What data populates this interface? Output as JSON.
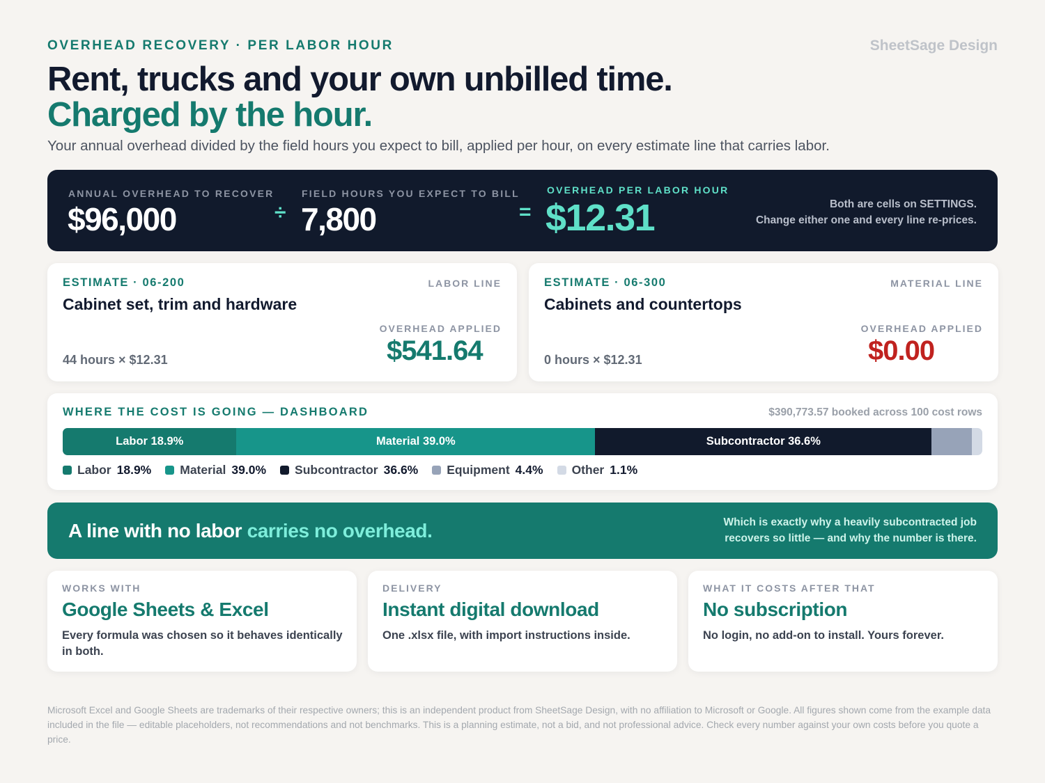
{
  "brand": "SheetSage Design",
  "eyebrow": "OVERHEAD RECOVERY · PER LABOR HOUR",
  "headline": "Rent, trucks and your own unbilled time.",
  "headline_accent": "Charged by the hour.",
  "subheadline": "Your annual overhead divided by the field hours you expect to bill, applied per hour, on every estimate line that carries labor.",
  "formula": {
    "overhead_label": "ANNUAL OVERHEAD TO RECOVER",
    "overhead_value": "$96,000",
    "divide_symbol": "÷",
    "hours_label": "FIELD HOURS YOU EXPECT TO BILL",
    "hours_value": "7,800",
    "equals_symbol": "=",
    "rate_label": "OVERHEAD PER LABOR HOUR",
    "rate_value": "$12.31",
    "note_line1": "Both are cells on SETTINGS.",
    "note_line2": "Change either one and every line re-prices."
  },
  "estimates": [
    {
      "code": "ESTIMATE · 06-200",
      "kind": "LABOR LINE",
      "title": "Cabinet set, trim and hardware",
      "applied_label": "OVERHEAD APPLIED",
      "formula": "44 hours × $12.31",
      "applied": "$541.64",
      "color": "#157a6e"
    },
    {
      "code": "ESTIMATE · 06-300",
      "kind": "MATERIAL LINE",
      "title": "Cabinets and countertops",
      "applied_label": "OVERHEAD APPLIED",
      "formula": "0 hours × $12.31",
      "applied": "$0.00",
      "color": "#c0221f"
    }
  ],
  "dashboard": {
    "title": "WHERE THE COST IS GOING — DASHBOARD",
    "booked": "$390,773.57 booked across 100 cost rows",
    "segments": [
      {
        "name": "Labor",
        "percent": 18.9,
        "pct_label": "18.9%",
        "bar_label": "Labor 18.9%",
        "color": "#157a6e"
      },
      {
        "name": "Material",
        "percent": 39.0,
        "pct_label": "39.0%",
        "bar_label": "Material 39.0%",
        "color": "#17958a"
      },
      {
        "name": "Subcontractor",
        "percent": 36.6,
        "pct_label": "36.6%",
        "bar_label": "Subcontractor 36.6%",
        "color": "#111a2c"
      },
      {
        "name": "Equipment",
        "percent": 4.4,
        "pct_label": "4.4%",
        "bar_label": "",
        "color": "#97a3b8"
      },
      {
        "name": "Other",
        "percent": 1.1,
        "pct_label": "1.1%",
        "bar_label": "",
        "color": "#d3dae5"
      }
    ]
  },
  "callout": {
    "main": "A line with no labor ",
    "main_accent": "carries no overhead.",
    "side_line1": "Which is exactly why a heavily subcontracted job",
    "side_line2": "recovers so little — and why the number is there."
  },
  "features": [
    {
      "label": "WORKS WITH",
      "head": "Google Sheets & Excel",
      "desc": "Every formula was chosen so it behaves identically in both."
    },
    {
      "label": "DELIVERY",
      "head": "Instant digital download",
      "desc": "One .xlsx file, with import instructions inside."
    },
    {
      "label": "WHAT IT COSTS AFTER THAT",
      "head": "No subscription",
      "desc": "No login, no add-on to install. Yours forever."
    }
  ],
  "footer": "Microsoft Excel and Google Sheets are trademarks of their respective owners; this is an independent product from SheetSage Design, with no affiliation to Microsoft or Google. All figures shown come from the example data included in the file — editable placeholders, not recommendations and not benchmarks. This is a planning estimate, not a bid, and not professional advice. Check every number against your own costs before you quote a price."
}
